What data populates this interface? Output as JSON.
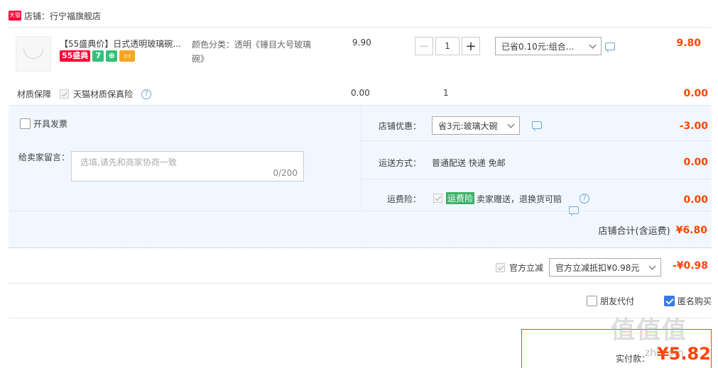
{
  "shop": {
    "logo_text": "天猫",
    "label": "店铺：行宁福旗舰店"
  },
  "item": {
    "title": "【55盛典价】日式透明玻璃碗...",
    "badges": {
      "promo": "55盛典",
      "seven": "7",
      "gift": "",
      "card": ""
    },
    "sku": "颜色分类：透明《锤目大号玻璃碗》",
    "unit_price": "9.90",
    "quantity": "1",
    "discount_select": "已省0.10元:组合...",
    "total": "9.80"
  },
  "material": {
    "label": "材质保障",
    "option": "天猫材质保真险",
    "price": "0.00",
    "qty": "1",
    "total": "0.00"
  },
  "invoice": {
    "label": "开具发票"
  },
  "message": {
    "label": "给卖家留言：",
    "placeholder": "选填,请先和商家协商一致",
    "counter": "0/200"
  },
  "shop_discount": {
    "label": "店铺优惠：",
    "value": "省3元:玻璃大碗",
    "amount": "-3.00"
  },
  "shipping": {
    "label": "运送方式：",
    "value": "普通配送 快递 免邮",
    "amount": "0.00"
  },
  "insurance": {
    "label": "运费险：",
    "tag": "运费险",
    "desc": "卖家赠送，退换货可赔",
    "amount": "0.00"
  },
  "shop_total": {
    "label": "店铺合计(含运费)",
    "amount": "¥6.80"
  },
  "official": {
    "label": "官方立减",
    "select": "官方立减抵扣¥0.98元",
    "amount": "-¥0.98"
  },
  "options": {
    "friend_pay": "朋友代付",
    "anonymous": "匿名购买"
  },
  "payment": {
    "label": "实付款：",
    "amount": "¥5.82"
  },
  "watermark": {
    "text": "值值值",
    "sub": "zhi.com"
  }
}
